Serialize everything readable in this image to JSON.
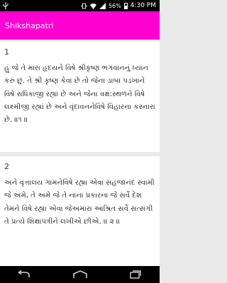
{
  "status_bar": {
    "battery_percent": "56%",
    "time": "4:30 PM"
  },
  "app_bar": {
    "title": "Shikshapatri"
  },
  "colors": {
    "accent": "#ff00d2",
    "status_bar": "#000000",
    "background": "#e9e9e9",
    "card": "#ffffff"
  },
  "verses": [
    {
      "number": "1",
      "text": "હું જે તે મારા હૃદયને વિષે શ્રીકૃષ્ણ ભગવાનનું ધ્યાન કરું છું. તે શ્રી કૃષ્ણ કેવા છે તો જેના ડાબા પડખાને વિષે રાધિકાજી રહ્યાં છે અને જેના વક્ષ:સ્થળને વિષે લક્ષ્મીજી રહ્યાં છે અને વૃંદાવનનેવિષે વિહારના કરનારા છે. ॥૧ ॥"
    },
    {
      "number": "2",
      "text": "અને વૃત્તાલય ગામનેવિષે રહ્યા એવા સહજાનંદ સ્વામી જે અમે, તે અમે જે તે નાના પ્રકારના જે સર્વે દેશ તેમને વિષે રહ્યા એવા જેઅમારા આશ્રિત સર્વે સત્સંગી તે પ્રત્યે શિક્ષાપત્રીને લખીએ છીએ. ॥ ૨ ॥"
    }
  ]
}
